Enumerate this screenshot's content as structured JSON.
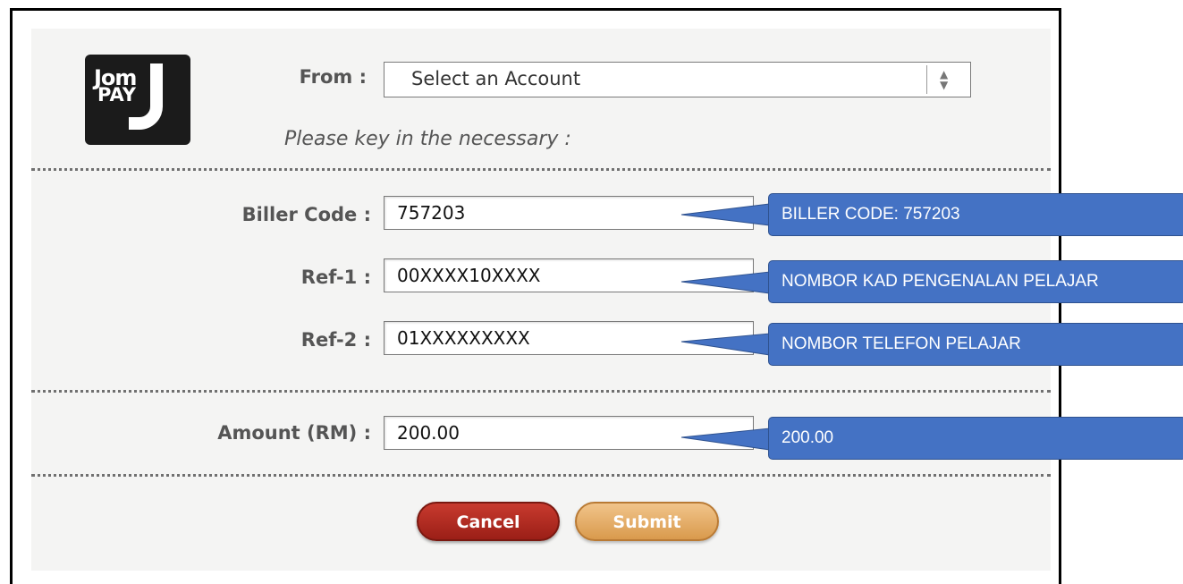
{
  "logo": {
    "line1": "Jom",
    "line2": "PAY"
  },
  "from": {
    "label": "From :",
    "value": "Select an Account"
  },
  "hint": "Please key in the necessary :",
  "fields": [
    {
      "label": "Biller Code :",
      "value": "757203"
    },
    {
      "label": "Ref-1 :",
      "value": "00XXXX10XXXX"
    },
    {
      "label": "Ref-2 :",
      "value": "01XXXXXXXXX"
    },
    {
      "label": "Amount (RM) :",
      "value": "200.00"
    }
  ],
  "callouts": [
    "BILLER CODE: 757203",
    "NOMBOR KAD PENGENALAN PELAJAR",
    "NOMBOR TELEFON PELAJAR",
    "200.00"
  ],
  "buttons": {
    "cancel": "Cancel",
    "submit": "Submit"
  },
  "colors": {
    "callout": "#4472c4",
    "cancel": "#b02a20",
    "submit": "#e7ae66"
  }
}
